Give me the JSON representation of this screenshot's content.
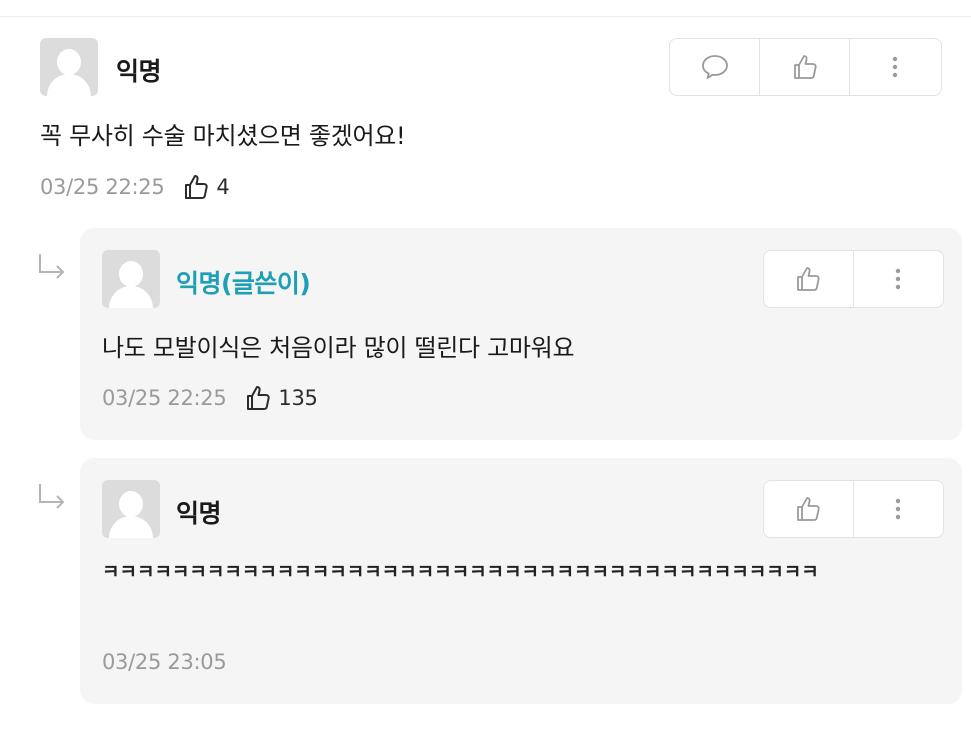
{
  "comments": [
    {
      "author": "익명",
      "text": "꼭 무사히 수술 마치셨으면 좋겠어요!",
      "timestamp": "03/25 22:25",
      "likes": "4"
    }
  ],
  "replies": [
    {
      "author": "익명(글쓴이)",
      "text": "나도 모발이식은 처음이라 많이 떨린다 고마워요",
      "timestamp": "03/25 22:25",
      "likes": "135"
    },
    {
      "author": "익명",
      "text": "ㅋㅋㅋㅋㅋㅋㅋㅋㅋㅋㅋㅋㅋㅋㅋㅋㅋㅋㅋㅋㅋㅋㅋㅋㅋㅋㅋㅋㅋㅋㅋㅋㅋㅋㅋㅋㅋㅋㅋㅋㅋ",
      "timestamp": "03/25 23:05"
    }
  ],
  "icons": {
    "reply": "speech-bubble-icon",
    "like": "thumbs-up-icon",
    "more": "more-vertical-icon",
    "reply_indicator": "reply-arrow-icon"
  },
  "colors": {
    "op_author": "#1d9fb5",
    "meta_text": "#9a9a9a",
    "reply_bg": "#f5f5f5"
  }
}
